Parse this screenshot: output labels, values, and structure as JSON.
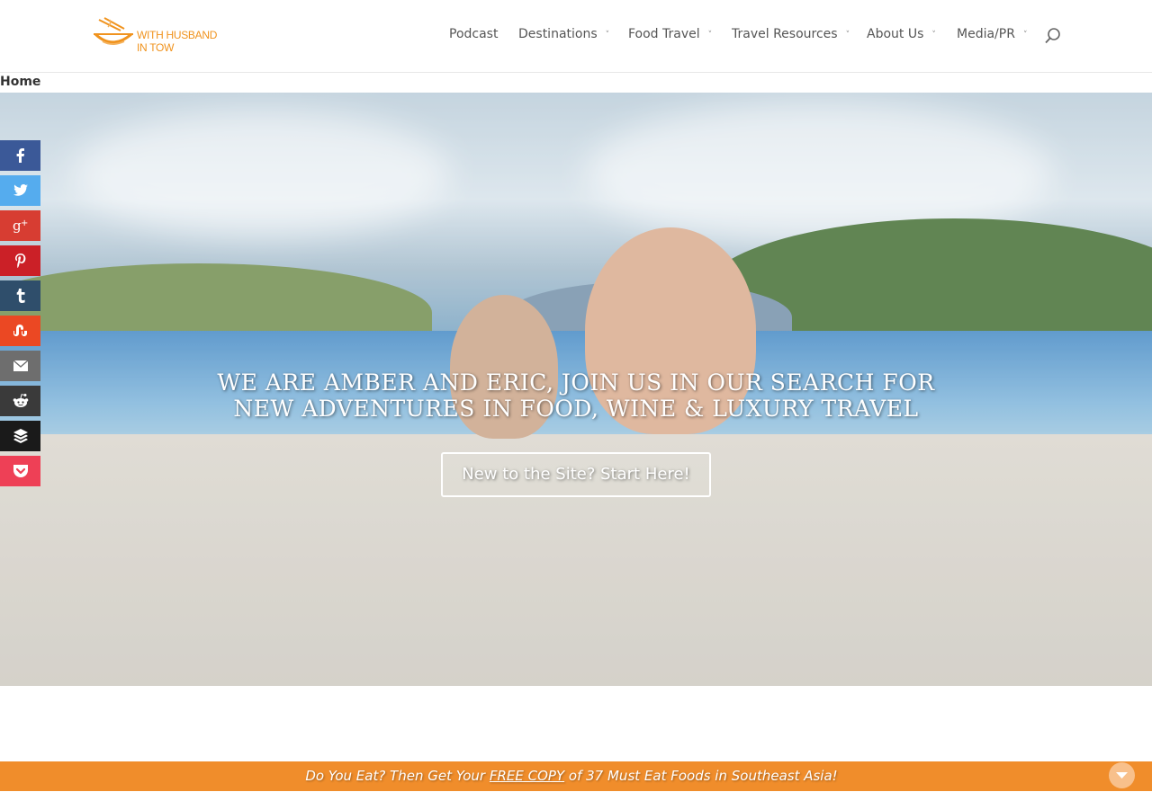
{
  "header": {
    "logo": {
      "line1": "WITH HUSBAND",
      "line2": "IN TOW"
    },
    "nav": [
      {
        "label": "Podcast",
        "has_dropdown": false
      },
      {
        "label": "Destinations",
        "has_dropdown": true
      },
      {
        "label": "Food Travel",
        "has_dropdown": true
      },
      {
        "label": "Travel Resources",
        "has_dropdown": true
      },
      {
        "label": "About Us",
        "has_dropdown": true
      },
      {
        "label": "Media/PR",
        "has_dropdown": true
      }
    ],
    "chevron_glyph": "˅",
    "search_icon": "search-icon"
  },
  "breadcrumb": {
    "label": "Home"
  },
  "hero": {
    "title": "WE ARE AMBER AND ERIC, JOIN US IN OUR SEARCH FOR NEW ADVENTURES IN FOOD, WINE & LUXURY TRAVEL",
    "cta_label": "New to the Site? Start Here!"
  },
  "social": [
    {
      "name": "facebook",
      "icon": "facebook-icon",
      "color": "#3b5998"
    },
    {
      "name": "twitter",
      "icon": "twitter-icon",
      "color": "#55acee"
    },
    {
      "name": "google-plus",
      "icon": "google-plus-icon",
      "color": "#d73d32"
    },
    {
      "name": "pinterest",
      "icon": "pinterest-icon",
      "color": "#cb2027"
    },
    {
      "name": "tumblr",
      "icon": "tumblr-icon",
      "color": "#2f4e6b"
    },
    {
      "name": "stumbleupon",
      "icon": "stumbleupon-icon",
      "color": "#eb4823"
    },
    {
      "name": "email",
      "icon": "email-icon",
      "color": "#6e6e6e"
    },
    {
      "name": "reddit",
      "icon": "reddit-icon",
      "color": "#3a3a3a"
    },
    {
      "name": "buffer",
      "icon": "buffer-icon",
      "color": "#1a1a1a"
    },
    {
      "name": "pocket",
      "icon": "pocket-icon",
      "color": "#ee4056"
    }
  ],
  "promo": {
    "text_before": "Do You Eat? Then Get Your ",
    "link_text": "FREE COPY",
    "text_after": " of 37 Must Eat Foods in Southeast Asia!",
    "toggle_icon": "chevron-down-icon"
  },
  "colors": {
    "brand_orange": "#f08d2b",
    "logo_orange": "#f0931e",
    "nav_text": "#555555"
  }
}
